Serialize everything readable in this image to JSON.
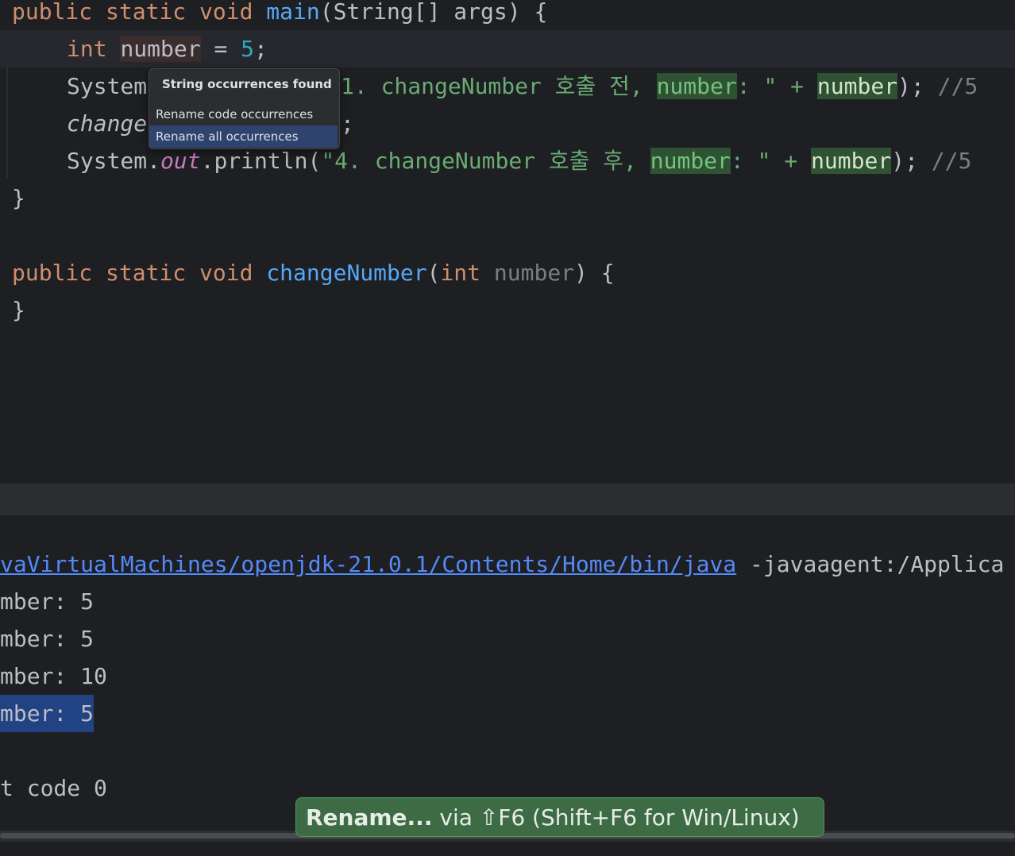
{
  "editor": {
    "line1": {
      "kw": "public static void ",
      "fn": "main",
      "rest": "(String[] args) {"
    },
    "line2": {
      "kw": "int ",
      "var": "number",
      "eq": " = ",
      "num": "5",
      "semi": ";"
    },
    "line3": {
      "a": "System",
      "b": "1. changeNumber 호출 전, ",
      "c": "number",
      "d": ": \" + ",
      "e": "number",
      "f": "); ",
      "g": "//5"
    },
    "line4": {
      "a": "change",
      "b": ";"
    },
    "line5": {
      "a": "System.",
      "field": "out",
      "b": ".println(",
      "str1": "\"4. changeNumber 호출 후, ",
      "c": "number",
      "d": ": \" + ",
      "e": "number",
      "f": "); ",
      "g": "//5"
    },
    "line6": "}",
    "line7": {
      "kw": "public static void ",
      "fn": "changeNumber",
      "p1": "(",
      "kw2": "int ",
      "param": "number",
      "p2": ") {"
    },
    "line8": "}"
  },
  "popup": {
    "title": "String occurrences found",
    "items": [
      "Rename code occurrences",
      "Rename all occurrences"
    ],
    "selected_index": 1
  },
  "console": {
    "cmd_link": "vaVirtualMachines/openjdk-21.0.1/Contents/Home/bin/java",
    "cmd_rest": " -javaagent:/Applica",
    "outputs": [
      "mber: 5",
      "mber: 5",
      "mber: 10",
      "mber: 5"
    ],
    "exit": "t code 0"
  },
  "hint": {
    "bold": "Rename...",
    "rest": " via ⇧F6 (Shift+F6 for Win/Linux)"
  },
  "colors": {
    "background": "#1e1f22",
    "keyword": "#cf8e6d",
    "function": "#56a8f5",
    "string": "#6aab73",
    "number": "#2aacb8",
    "selection": "#214283",
    "hint_bg": "#3c6b44"
  }
}
